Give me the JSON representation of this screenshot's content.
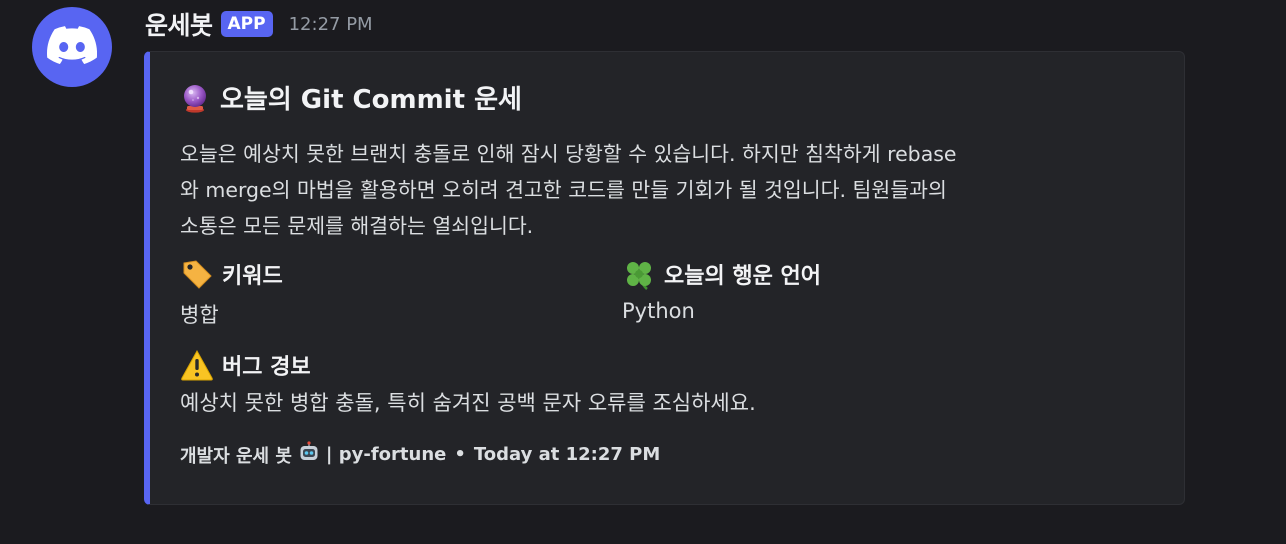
{
  "author": {
    "name": "운세봇",
    "badge": "APP",
    "timestamp": "12:27 PM",
    "avatar_icon": "discord-logo-icon",
    "avatar_color": "#5865f2"
  },
  "embed": {
    "accent_color": "#5865f2",
    "title_icon": "crystal-ball-icon",
    "title": "오늘의 Git Commit 운세",
    "description": "오늘은 예상치 못한 브랜치 충돌로 인해 잠시 당황할 수 있습니다. 하지만 침착하게 rebase\n와 merge의 마법을 활용하면 오히려 견고한 코드를 만들 기회가 될 것입니다. 팀원들과의\n소통은 모든 문제를 해결하는 열쇠입니다.",
    "fields": [
      {
        "icon": "label-tag-icon",
        "name": "키워드",
        "value": "병합"
      },
      {
        "icon": "four-leaf-clover-icon",
        "name": "오늘의 행운 언어",
        "value": "Python"
      },
      {
        "icon": "warning-icon",
        "name": "버그 경보",
        "value": "예상치 못한 병합 충돌, 특히 숨겨진 공백 문자 오류를 조심하세요."
      }
    ],
    "footer": {
      "text": "개발자 운세 봇",
      "icon": "robot-icon",
      "source": "| py-fortune",
      "bullet": "•",
      "time": "Today at 12:27 PM"
    }
  }
}
